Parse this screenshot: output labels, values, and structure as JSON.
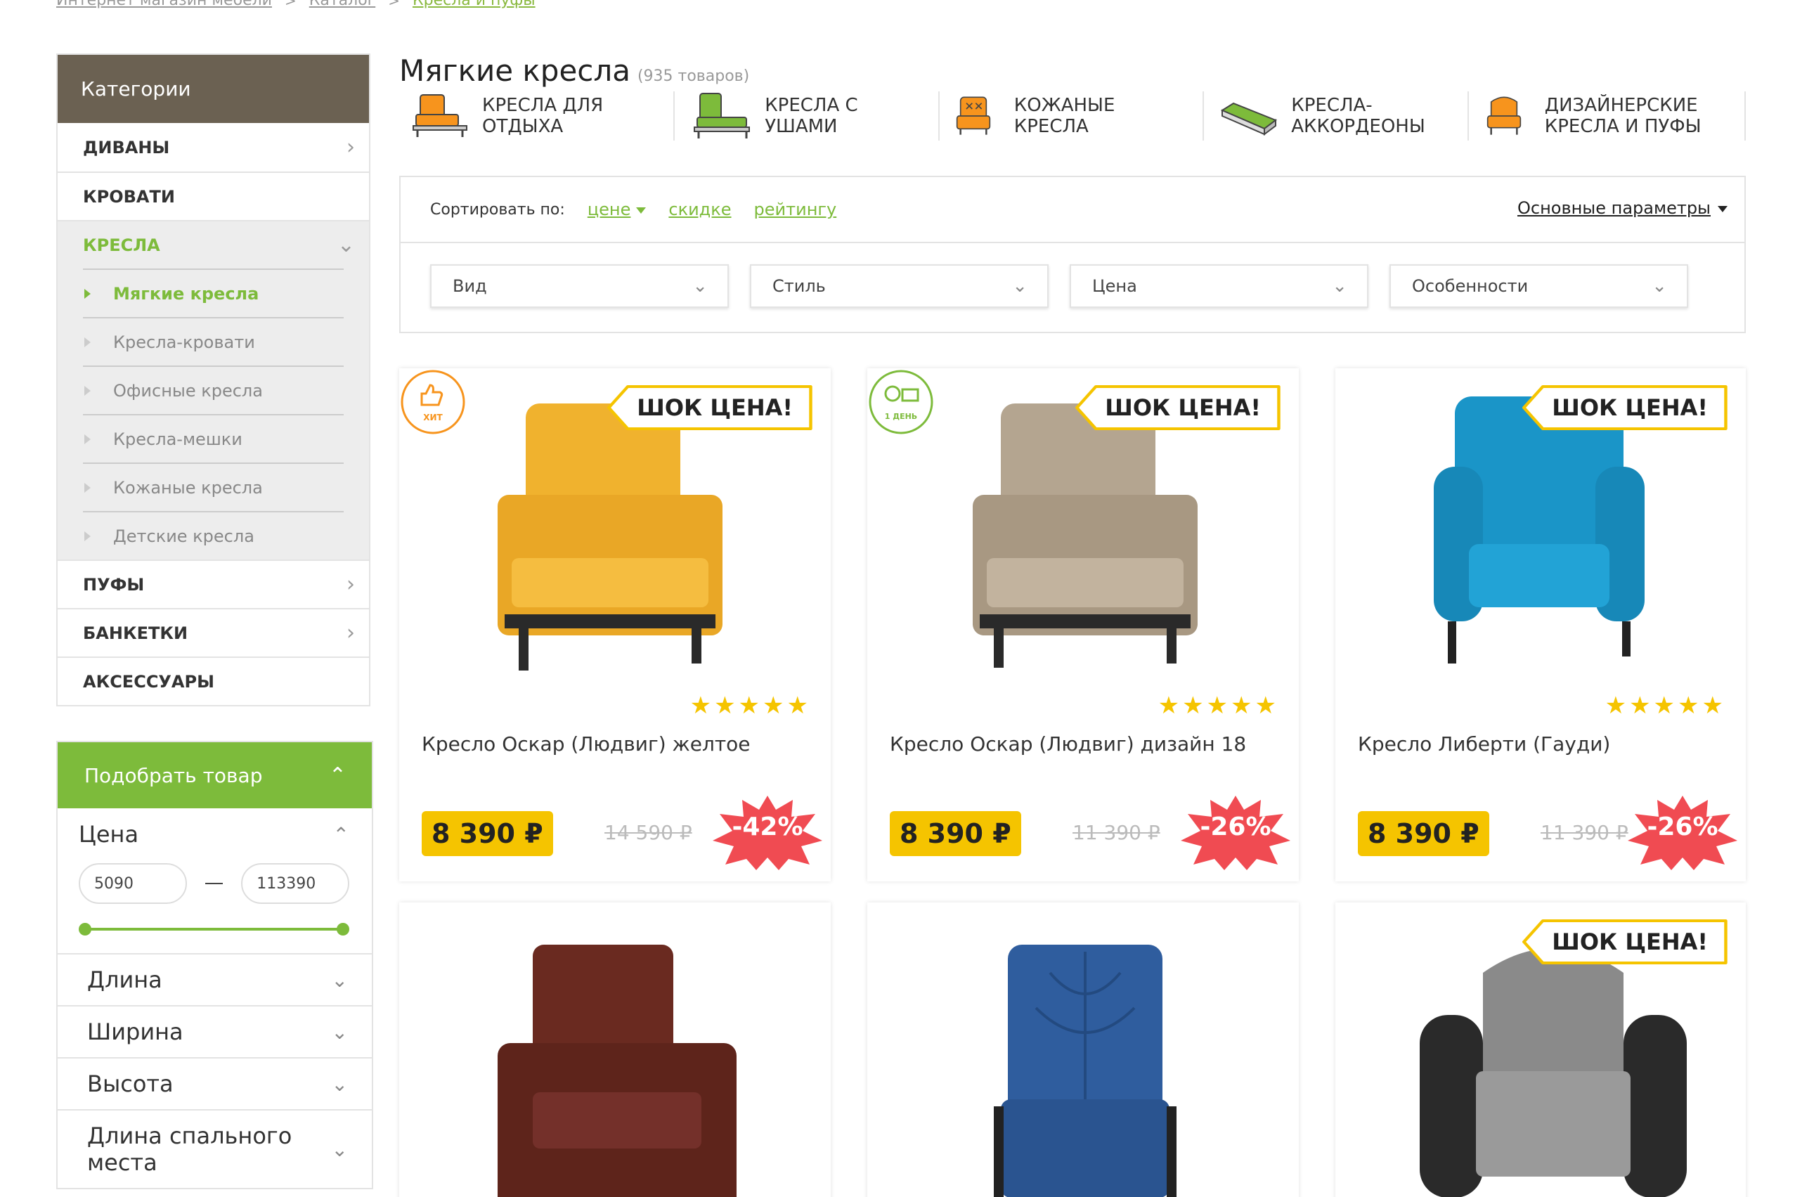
{
  "breadcrumb": [
    "Интернет магазин мебели",
    "Каталог",
    "Кресла и пуфы"
  ],
  "sidebar": {
    "header": "Категории",
    "items": [
      {
        "label": "ДИВАНЫ",
        "has_arrow": true
      },
      {
        "label": "КРОВАТИ",
        "has_arrow": false
      },
      {
        "label": "КРЕСЛА",
        "expanded": true
      },
      {
        "label": "ПУФЫ",
        "has_arrow": true
      },
      {
        "label": "БАНКЕТКИ",
        "has_arrow": true
      },
      {
        "label": "АКСЕССУАРЫ",
        "has_arrow": false
      }
    ],
    "subitems": [
      "Мягкие кресла",
      "Кресла-кровати",
      "Офисные кресла",
      "Кресла-мешки",
      "Кожаные кресла",
      "Детские кресла"
    ],
    "active_subitem": "Мягкие кресла"
  },
  "filter": {
    "header": "Подобрать товар",
    "price_label": "Цена",
    "price_min": "5090",
    "price_max": "113390",
    "rows": [
      "Длина",
      "Ширина",
      "Высота",
      "Длина спального места"
    ]
  },
  "main": {
    "title": "Мягкие кресла",
    "count": "(935 товаров)",
    "subnav": [
      {
        "label": "КРЕСЛА ДЛЯ ОТДЫХА",
        "icon": "armchair-orange-icon"
      },
      {
        "label": "КРЕСЛА С УШАМИ",
        "icon": "wingchair-green-icon"
      },
      {
        "label": "КОЖАНЫЕ КРЕСЛА",
        "icon": "leather-chair-icon"
      },
      {
        "label": "КРЕСЛА-АККОРДЕОНЫ",
        "icon": "accordion-chair-icon"
      },
      {
        "label": "ДИЗАЙНЕРСКИЕ КРЕСЛА И ПУФЫ",
        "icon": "designer-chair-icon"
      }
    ],
    "sort": {
      "label": "Сортировать по:",
      "options": [
        "цене",
        "скидке",
        "рейтингу"
      ],
      "params": "Основные параметры"
    },
    "dropdowns": [
      "Вид",
      "Стиль",
      "Цена",
      "Особенности"
    ]
  },
  "products": [
    {
      "name": "Кресло Оскар (Людвиг) желтое",
      "price": "8 390 ₽",
      "old_price": "14 590 ₽",
      "discount": "-42%",
      "shock": "ШОК ЦЕНА!",
      "badge": "ХИТ",
      "rating": 5,
      "color": "#f0b22e"
    },
    {
      "name": "Кресло Оскар (Людвиг) дизайн 18",
      "price": "8 390 ₽",
      "old_price": "11 390 ₽",
      "discount": "-26%",
      "shock": "ШОК ЦЕНА!",
      "badge": "1 ДЕНЬ",
      "rating": 5,
      "color": "#b4a590"
    },
    {
      "name": "Кресло Либерти (Гауди)",
      "price": "8 390 ₽",
      "old_price": "11 390 ₽",
      "discount": "-26%",
      "shock": "ШОК ЦЕНА!",
      "badge": "",
      "rating": 5,
      "color": "#1a95c8"
    },
    {
      "name": "",
      "shock": "",
      "color": "#6a2a20"
    },
    {
      "name": "",
      "shock": "",
      "color": "#2f5d9e"
    },
    {
      "name": "",
      "shock": "ШОК ЦЕНА!",
      "color": "#8a8a8a"
    }
  ],
  "colors": {
    "accent_green": "#7dbb3b",
    "header_brown": "#6b6152",
    "yellow": "#f5c400",
    "discount_red": "#f04b52"
  }
}
